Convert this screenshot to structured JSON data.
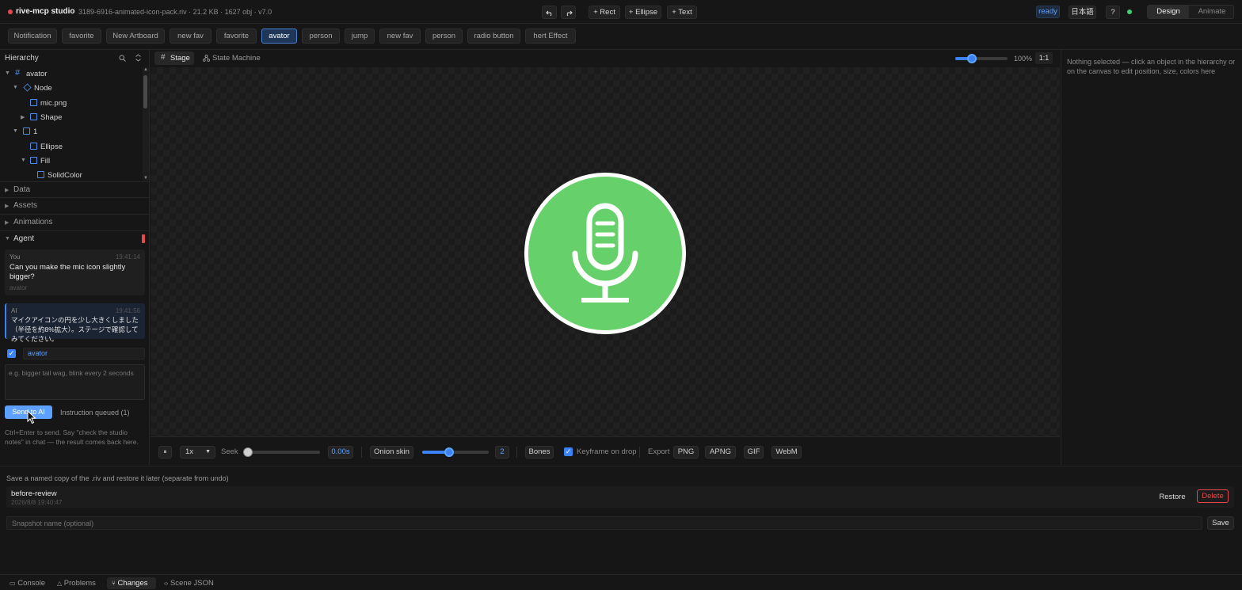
{
  "header": {
    "app_title": "rive-mcp studio",
    "file_meta": "3189-6916-animated-icon-pack.riv · 21.2 KB · 1627 obj · v7.0",
    "undo_icon": "undo-icon",
    "redo_icon": "redo-icon",
    "add_rect": "+ Rect",
    "add_ellipse": "+ Ellipse",
    "add_text": "+ Text",
    "status": "ready",
    "language": "日本語",
    "help": "?",
    "mode_design": "Design",
    "mode_animate": "Animate",
    "active_mode": "Design"
  },
  "artboard_tabs": [
    {
      "label": "Notification",
      "active": false
    },
    {
      "label": "favorite",
      "active": false
    },
    {
      "label": "New Artboard",
      "active": false
    },
    {
      "label": "new fav",
      "active": false
    },
    {
      "label": "favorite",
      "active": false
    },
    {
      "label": "avator",
      "active": true
    },
    {
      "label": "person",
      "active": false
    },
    {
      "label": "jump",
      "active": false
    },
    {
      "label": "new fav",
      "active": false
    },
    {
      "label": "person",
      "active": false
    },
    {
      "label": "radio button",
      "active": false
    },
    {
      "label": "hert Effect",
      "active": false
    }
  ],
  "hierarchy": {
    "title": "Hierarchy",
    "nodes": [
      {
        "name": "avator",
        "icon": "artboard-icon",
        "expanded": true
      },
      {
        "name": "Node",
        "icon": "node-icon",
        "expanded": true
      },
      {
        "name": "mic.png",
        "icon": "image-icon"
      },
      {
        "name": "Shape",
        "icon": "shape-icon",
        "expanded": false
      },
      {
        "name": "1",
        "icon": "shape-icon",
        "expanded": true
      },
      {
        "name": "Ellipse",
        "icon": "shape-icon"
      },
      {
        "name": "Fill",
        "icon": "shape-icon",
        "expanded": true
      },
      {
        "name": "SolidColor",
        "icon": "shape-icon"
      }
    ]
  },
  "sections": {
    "data": "Data",
    "assets": "Assets",
    "animations": "Animations",
    "agent": "Agent"
  },
  "agent": {
    "messages": [
      {
        "who": "You",
        "time": "19:41:14",
        "text": "Can you make the mic icon slightly bigger?",
        "context": "avator"
      },
      {
        "who": "AI",
        "time": "19:41:56",
        "text": "マイクアイコンの円を少し大きくしました（半径を約8%拡大）。ステージで確認してみてください。"
      }
    ],
    "target_checked": true,
    "target": "avator",
    "input_placeholder": "e.g. bigger tail wag, blink every 2 seconds",
    "send_label": "Send to AI",
    "queued_label": "Instruction queued (1)",
    "hint": "Ctrl+Enter to send. Say \"check the studio notes\" in chat — the result comes back here."
  },
  "stage": {
    "tab_stage": "Stage",
    "tab_state_machine": "State Machine",
    "zoom": "100%",
    "zoom_fraction": 0.32,
    "fit_label": "1:1",
    "icon_color": "#66d06a"
  },
  "timeline": {
    "play_icon": "pause-icon",
    "speed": "1x",
    "seek_label": "Seek",
    "seek_fraction": 0,
    "time": "0.00s",
    "onion_skin": "Onion skin",
    "onion_fraction": 0.4,
    "onion_count": "2",
    "bones": "Bones",
    "keyframe_on_drop_checked": true,
    "keyframe_on_drop": "Keyframe on drop",
    "export_label": "Export",
    "export_png": "PNG",
    "export_apng": "APNG",
    "export_gif": "GIF",
    "export_webm": "WebM"
  },
  "inspector": {
    "empty_text": "Nothing selected — click an object in the hierarchy or on the canvas to edit position, size, colors here"
  },
  "snapshots": {
    "description": "Save a named copy of the .riv and restore it later (separate from undo)",
    "items": [
      {
        "name": "before-review",
        "date": "2026/8/8 19:40:47"
      }
    ],
    "restore_label": "Restore",
    "delete_label": "Delete",
    "name_placeholder": "Snapshot name (optional)",
    "save_label": "Save"
  },
  "bottom_tabs": [
    {
      "label": "Console",
      "icon": "console-icon",
      "active": false
    },
    {
      "label": "Problems",
      "icon": "warning-icon",
      "active": false
    },
    {
      "label": "Changes",
      "icon": "branch-icon",
      "active": true
    },
    {
      "label": "Scene JSON",
      "icon": "code-icon",
      "active": false
    }
  ]
}
